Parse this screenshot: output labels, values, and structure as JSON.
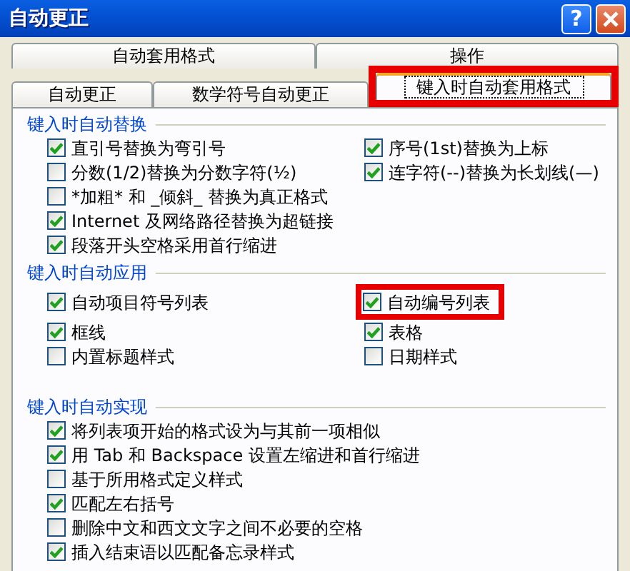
{
  "window": {
    "title": "自动更正",
    "help": "?"
  },
  "tab_rows": [
    [
      {
        "label": "自动套用格式",
        "selected": false,
        "highlighted": false
      },
      {
        "label": "操作",
        "selected": false,
        "highlighted": false
      }
    ],
    [
      {
        "label": "自动更正",
        "selected": false,
        "highlighted": false
      },
      {
        "label": "数学符号自动更正",
        "selected": false,
        "highlighted": false
      },
      {
        "label": "键入时自动套用格式",
        "selected": true,
        "highlighted": true
      }
    ]
  ],
  "groups": [
    {
      "title": "键入时自动替换",
      "left": [
        {
          "label": "直引号替换为弯引号",
          "checked": true,
          "highlighted": false
        },
        {
          "label": "分数(1/2)替换为分数字符(½)",
          "checked": false,
          "highlighted": false
        },
        {
          "label": "*加粗* 和 _倾斜_ 替换为真正格式",
          "checked": false,
          "highlighted": false
        },
        {
          "label": "Internet 及网络路径替换为超链接",
          "checked": true,
          "highlighted": false
        },
        {
          "label": "段落开头空格采用首行缩进",
          "checked": true,
          "highlighted": false
        }
      ],
      "right": [
        {
          "label": "序号(1st)替换为上标",
          "checked": true,
          "highlighted": false
        },
        {
          "label": "连字符(--)替换为长划线(—)",
          "checked": true,
          "highlighted": false
        }
      ]
    },
    {
      "title": "键入时自动应用",
      "left": [
        {
          "label": "自动项目符号列表",
          "checked": true,
          "highlighted": false
        },
        {
          "label": "框线",
          "checked": true,
          "highlighted": false
        },
        {
          "label": "内置标题样式",
          "checked": false,
          "highlighted": false
        }
      ],
      "right": [
        {
          "label": "自动编号列表",
          "checked": true,
          "highlighted": true
        },
        {
          "label": "表格",
          "checked": true,
          "highlighted": false
        },
        {
          "label": "日期样式",
          "checked": false,
          "highlighted": false
        }
      ]
    },
    {
      "title": "键入时自动实现",
      "left": [
        {
          "label": "将列表项开始的格式设为与其前一项相似",
          "checked": true,
          "highlighted": false
        },
        {
          "label": "用 Tab 和 Backspace 设置左缩进和首行缩进",
          "checked": true,
          "highlighted": false
        },
        {
          "label": "基于所用格式定义样式",
          "checked": false,
          "highlighted": false
        },
        {
          "label": "匹配左右括号",
          "checked": true,
          "highlighted": false
        },
        {
          "label": "删除中文和西文文字之间不必要的空格",
          "checked": false,
          "highlighted": false
        },
        {
          "label": "插入结束语以匹配备忘录样式",
          "checked": true,
          "highlighted": false
        }
      ]
    }
  ]
}
